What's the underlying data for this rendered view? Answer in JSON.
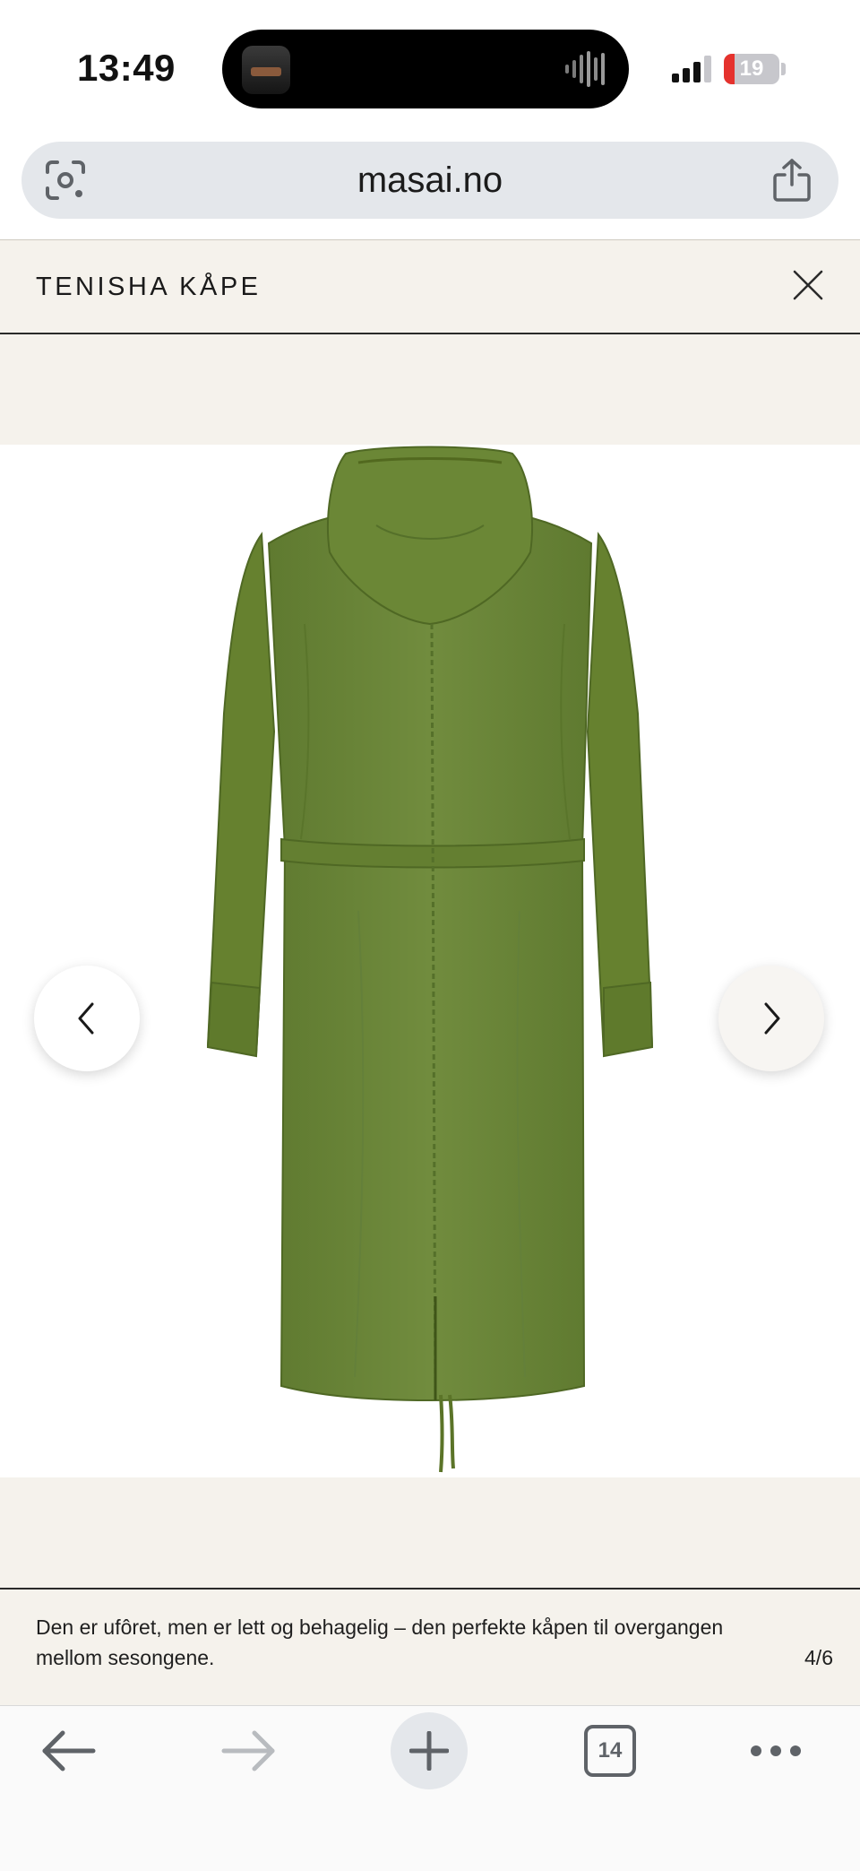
{
  "status_bar": {
    "time": "13:49",
    "battery_level": "19",
    "battery_fill_percent": 19
  },
  "browser": {
    "url": "masai.no",
    "tab_count": "14"
  },
  "modal": {
    "title": "TENISHA KÅPE",
    "caption": "Den er ufôret, men er lett og behagelig – den perfekte kåpen til overgangen mellom sesongene.",
    "counter": "4/6"
  },
  "colors": {
    "modal_bg": "#f5f2ec",
    "garment": "#6f8a3c",
    "battery_low": "#e5322d"
  },
  "icons": {
    "lens": "camera-search-icon",
    "share": "share-icon",
    "close": "close-icon",
    "prev": "chevron-left-icon",
    "next": "chevron-right-icon",
    "back": "arrow-left-icon",
    "forward": "arrow-right-icon",
    "new_tab": "plus-icon",
    "more": "more-dots-icon"
  }
}
